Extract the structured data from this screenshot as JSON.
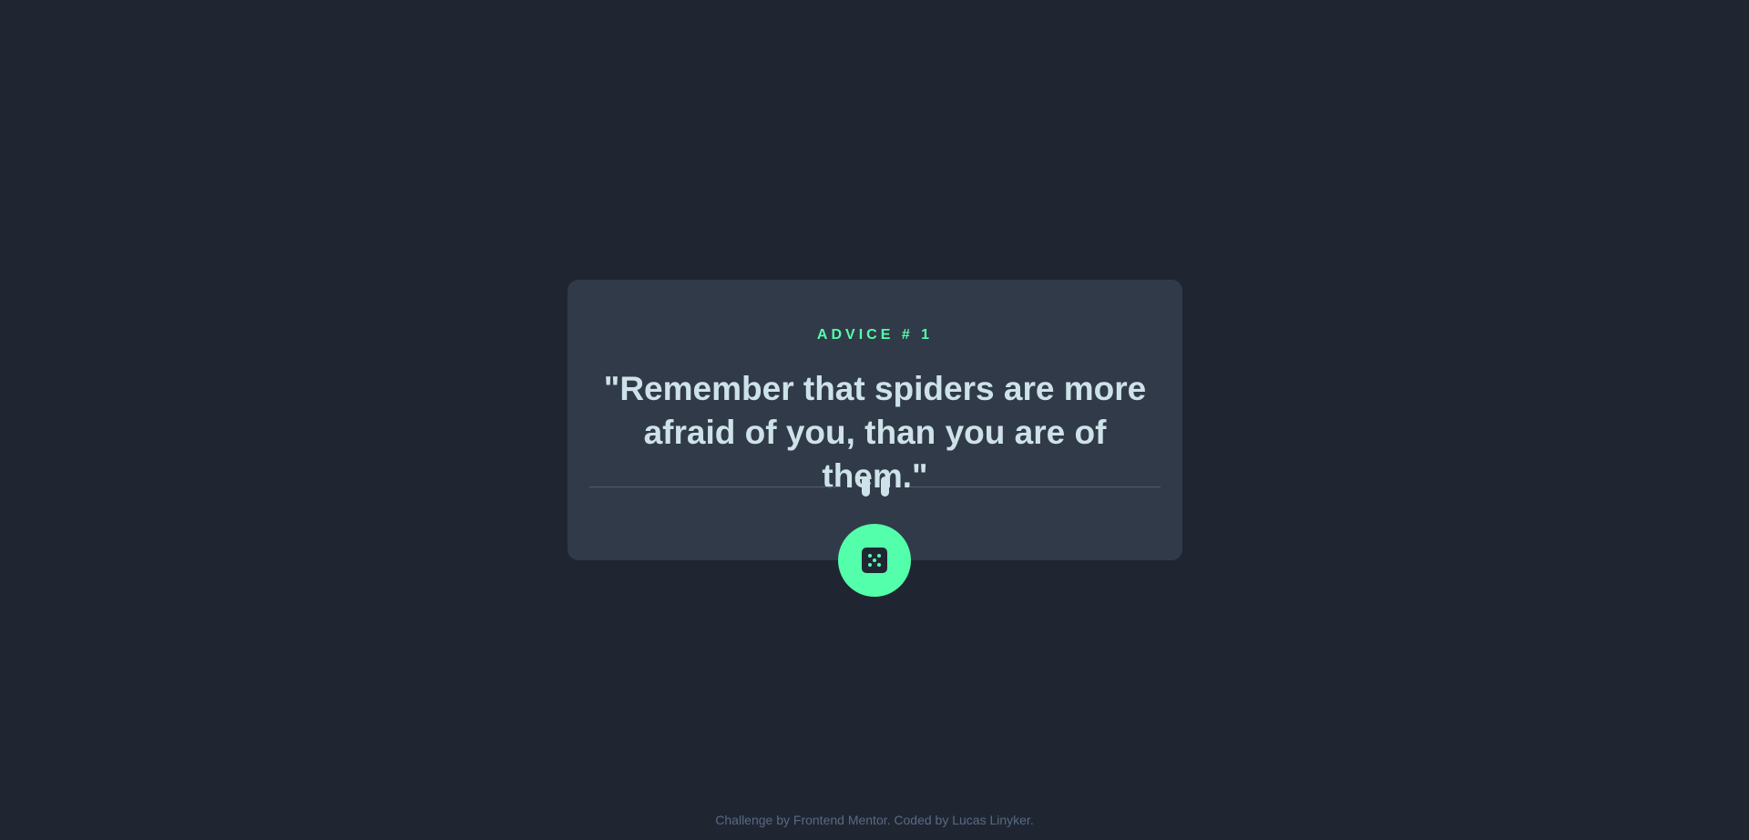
{
  "card": {
    "advice_id": "ADVICE # 1",
    "advice_text": "\"Remember that spiders are more afraid of you, than you are of them.\""
  },
  "icons": {
    "divider_icon": "pause-icon",
    "button_icon": "dice-icon"
  },
  "footer": {
    "attribution": "Challenge by Frontend Mentor. Coded by Lucas Linyker."
  },
  "colors": {
    "background": "#1f2631",
    "card": "#313a48",
    "accent": "#53ffaa",
    "text": "#cee3e9",
    "muted": "#586984"
  }
}
